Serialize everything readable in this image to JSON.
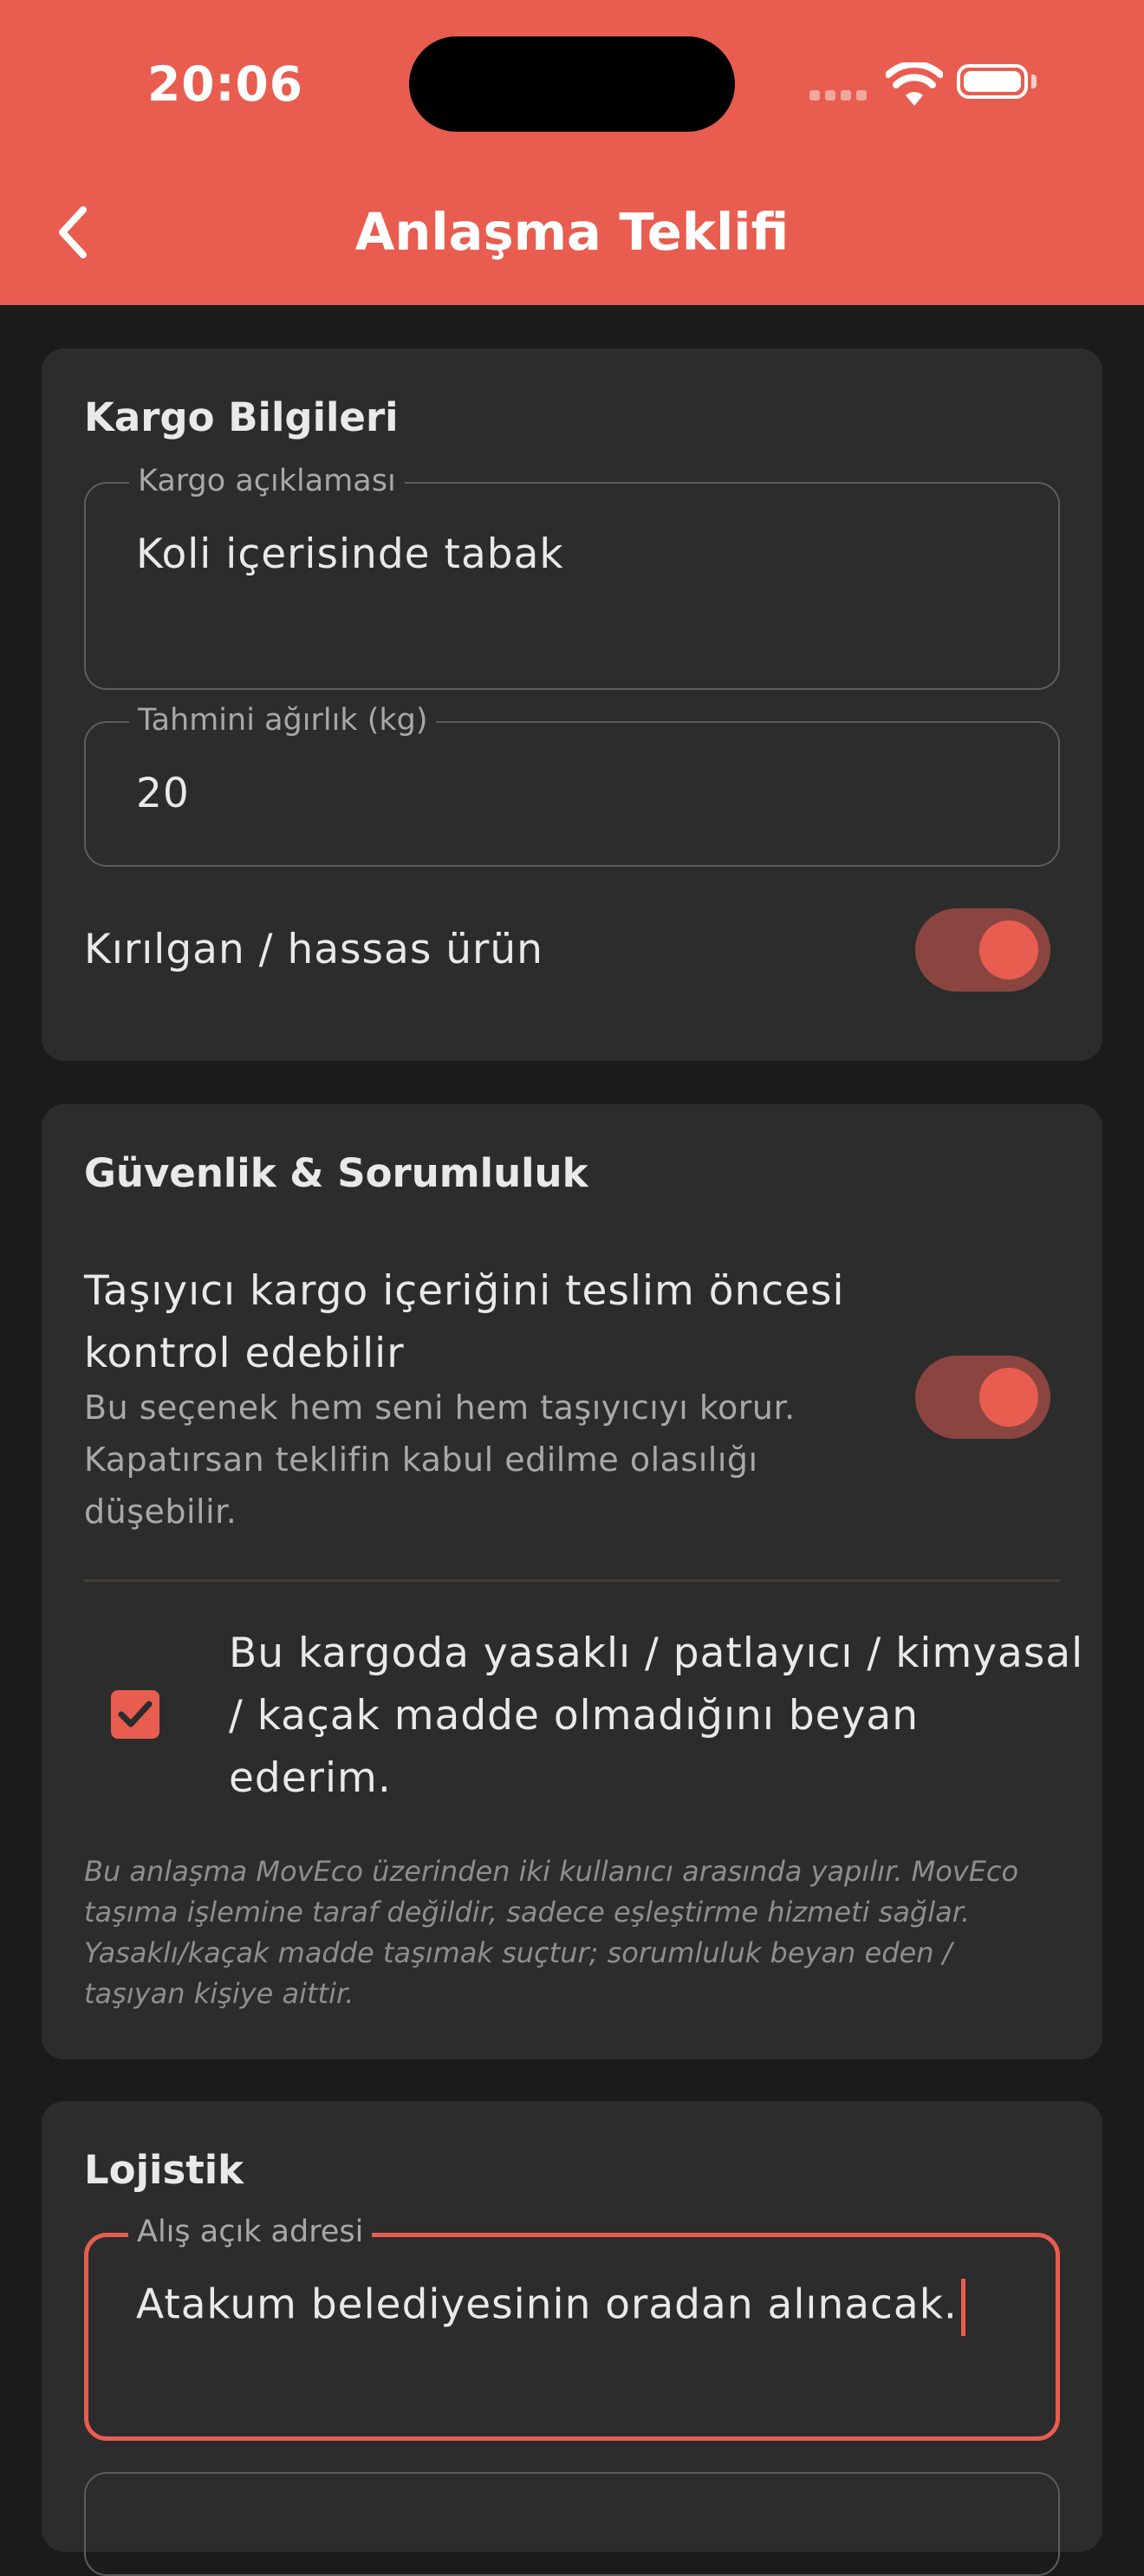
{
  "status_bar": {
    "time": "20:06"
  },
  "header": {
    "title": "Anlaşma Teklifi"
  },
  "cargo_card": {
    "title": "Kargo Bilgileri",
    "description_label": "Kargo açıklaması",
    "description_value": "Koli içerisinde tabak",
    "weight_label": "Tahmini ağırlık (kg)",
    "weight_value": "20",
    "fragile_label": "Kırılgan / hassas ürün",
    "fragile_on": true
  },
  "security_card": {
    "title": "Güvenlik & Sorumluluk",
    "inspect_label_line1": "Taşıyıcı kargo içeriğini teslim öncesi",
    "inspect_label_line2": "kontrol edebilir",
    "inspect_hint_line1": "Bu seçenek hem seni hem taşıyıcıyı korur.",
    "inspect_hint_line2": "Kapatırsan teklifin kabul edilme olasılığı",
    "inspect_hint_line3": "düşebilir.",
    "inspect_on": true,
    "declaration_line1": "Bu kargoda yasaklı / patlayıcı / kimyasal",
    "declaration_line2": "/ kaçak madde olmadığını beyan",
    "declaration_line3": "ederim.",
    "declaration_checked": true,
    "disclaimer_line1": "Bu anlaşma MovEco üzerinden iki kullanıcı arasında yapılır. MovEco",
    "disclaimer_line2": "taşıma işlemine taraf değildir, sadece eşleştirme hizmeti sağlar.",
    "disclaimer_line3": "Yasaklı/kaçak madde taşımak suçtur; sorumluluk beyan eden /",
    "disclaimer_line4": "taşıyan kişiye aittir."
  },
  "logistics_card": {
    "title": "Lojistik",
    "pickup_label": "Alış açık adresi",
    "pickup_value": "Atakum belediyesinin oradan alınacak."
  },
  "colors": {
    "accent": "#e85d4f",
    "background": "#1b1b1b",
    "card": "#2c2c2c"
  },
  "icons": [
    "back-chevron-icon",
    "wifi-icon",
    "battery-icon",
    "checkmark-icon"
  ]
}
